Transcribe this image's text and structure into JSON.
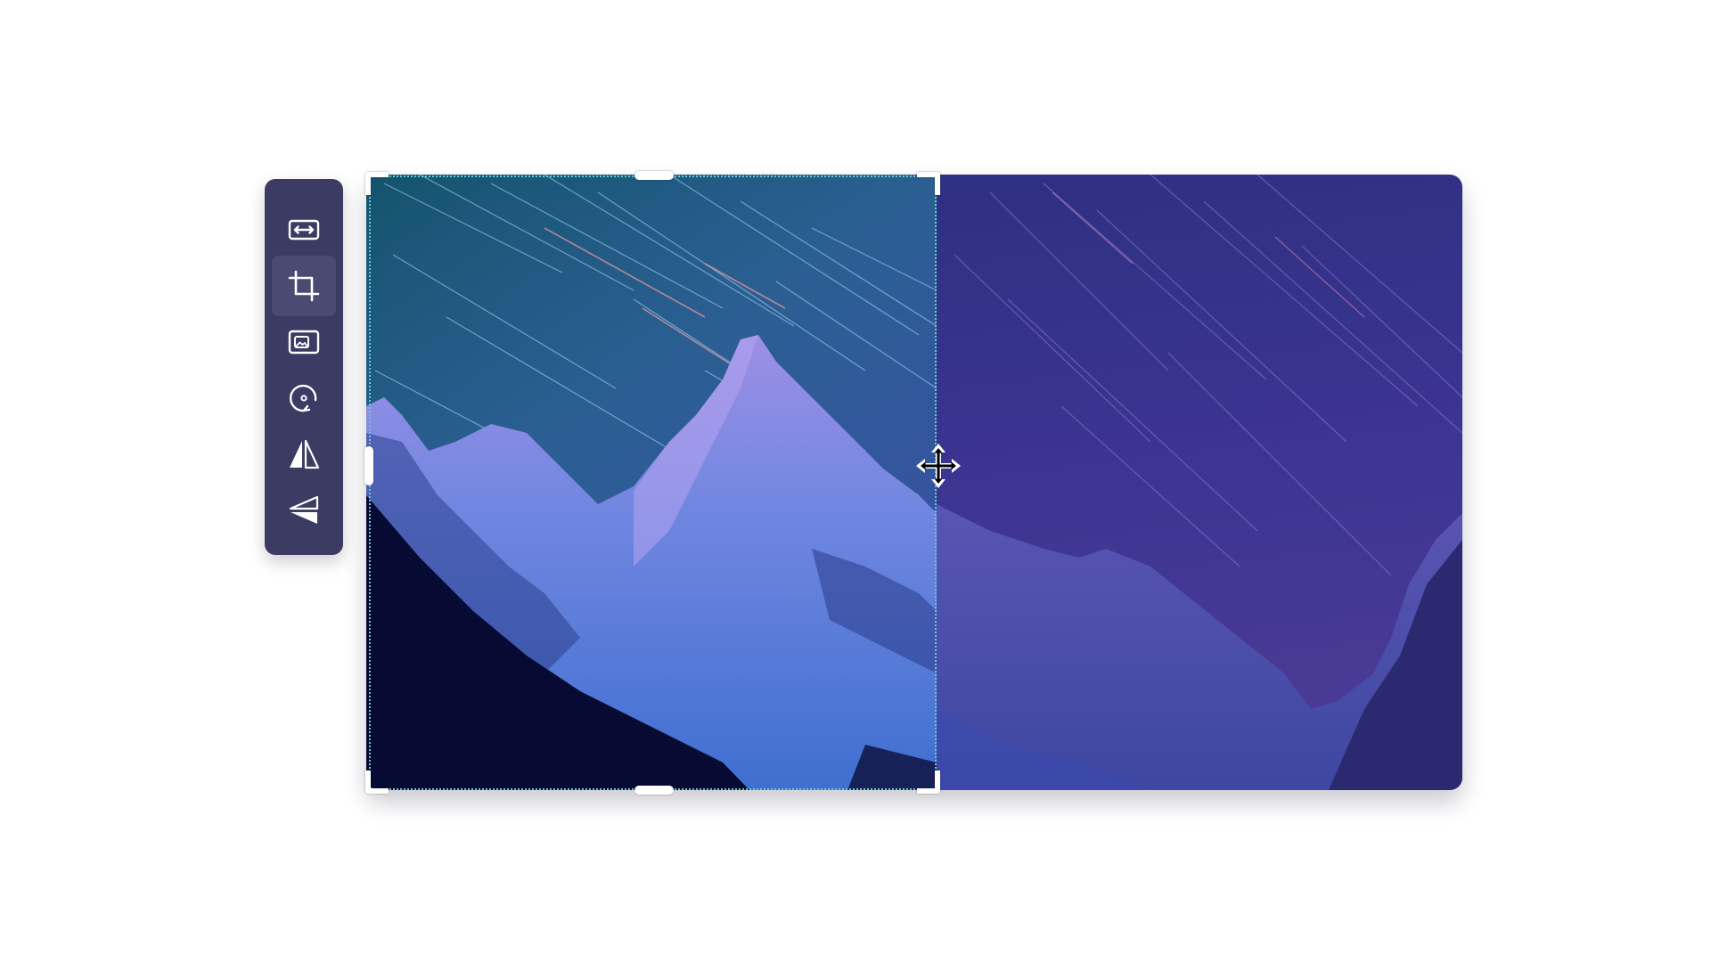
{
  "app": {
    "title": ""
  },
  "toolbar": {
    "active_tool": "crop",
    "tools": [
      {
        "id": "resize",
        "icon": "resize-icon",
        "active": false
      },
      {
        "id": "crop",
        "icon": "crop-icon",
        "active": true
      },
      {
        "id": "replace-image",
        "icon": "image-icon",
        "active": false
      },
      {
        "id": "rotate",
        "icon": "rotate-icon",
        "active": false
      },
      {
        "id": "flip-horizontal",
        "icon": "flip-horizontal-icon",
        "active": false
      },
      {
        "id": "flip-vertical",
        "icon": "flip-vertical-icon",
        "active": false
      }
    ]
  },
  "canvas": {
    "image_subject": "star-trails-over-snowy-mountain",
    "crop_selection": {
      "handles": [
        "top-left-corner",
        "top-right-corner",
        "bottom-left-corner",
        "bottom-right-corner",
        "top-edge",
        "bottom-edge",
        "left-edge"
      ]
    },
    "cursor": "move-cursor"
  },
  "colors": {
    "toolbar_bg": "#3c3b63",
    "toolbar_active": "#4b4a72",
    "icon": "#ffffff",
    "crop_border": "#63c9cf",
    "outside_crop_tint": "#2e2a78"
  }
}
